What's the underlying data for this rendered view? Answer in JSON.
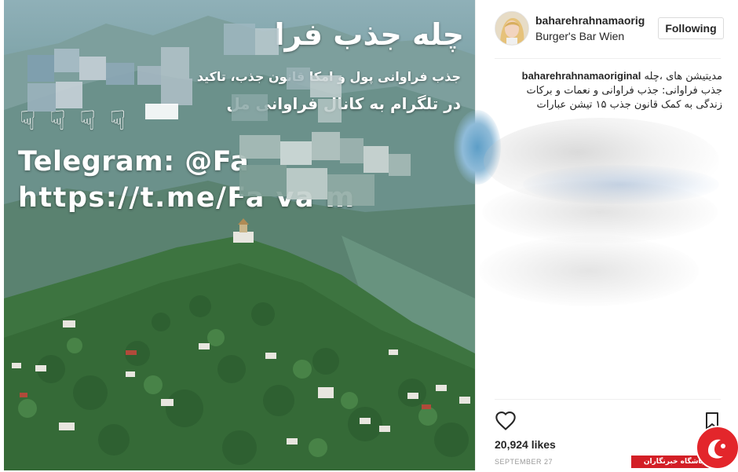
{
  "post": {
    "image": {
      "title": "چله جذب فرا",
      "line1": "جذب فراوانی پول و امکا     قانون جذب،     تاکید",
      "line2": "در تلگرام به کانال     فراوانی مل",
      "hands": "☟ ☟ ☟ ☟",
      "telegram": "Telegram: @Fa",
      "url": "https://t.me/Fa     va     m"
    },
    "header": {
      "username": "baharehrahnamaoriginal",
      "location": "Burger's Bar Wien",
      "follow_label": "Following"
    },
    "caption": {
      "username": "baharehrahnamaoriginal",
      "text_line1": "مدیتیشن های ،چله",
      "text_line2": "جذب فراوانی: جذب فراوانی و نعمات و برکات",
      "text_line3": "زندگی به کمک قانون جذب ۱۵ تیشن عبارات"
    },
    "actions": {
      "like_icon": "heart-icon",
      "save_icon": "bookmark-icon"
    },
    "likes": "20,924 likes",
    "date": "SEPTEMBER 27"
  },
  "watermark": {
    "text": "باشگاه خبرنگاران",
    "color": "#d31f26"
  },
  "colors": {
    "text": "#262626",
    "muted": "#999999",
    "border": "#dbdbdb"
  }
}
